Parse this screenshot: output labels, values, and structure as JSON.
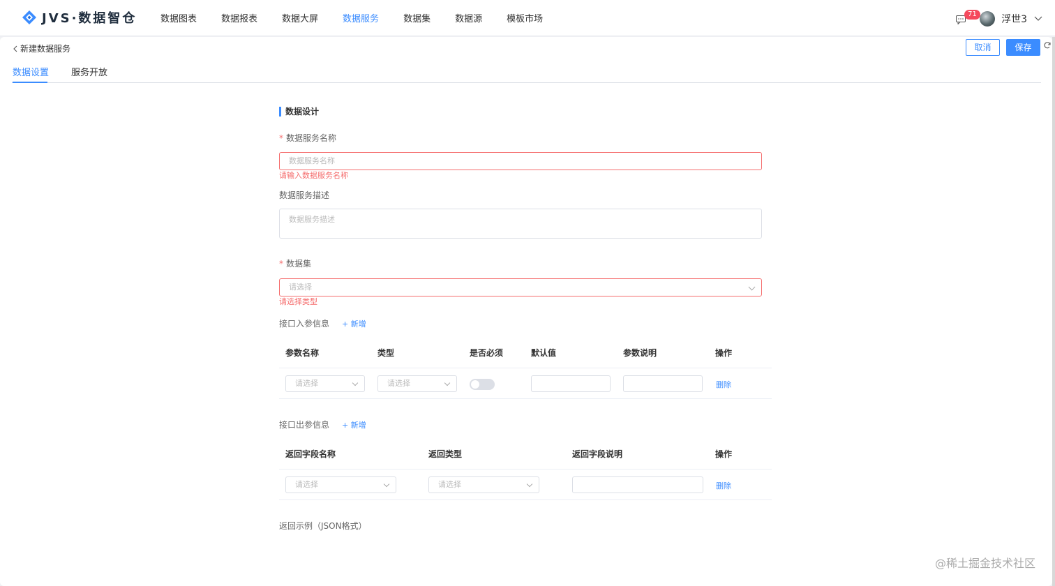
{
  "app": {
    "logo_text": "JVS·数据智仓"
  },
  "nav": {
    "items": [
      {
        "label": "数据图表",
        "active": false
      },
      {
        "label": "数据报表",
        "active": false
      },
      {
        "label": "数据大屏",
        "active": false
      },
      {
        "label": "数据服务",
        "active": true
      },
      {
        "label": "数据集",
        "active": false
      },
      {
        "label": "数据源",
        "active": false
      },
      {
        "label": "模板市场",
        "active": false
      }
    ]
  },
  "user": {
    "badge": "71",
    "name": "浮世3"
  },
  "header": {
    "back_label": "新建数据服务",
    "cancel": "取消",
    "save": "保存"
  },
  "tabs": [
    {
      "label": "数据设置",
      "active": true
    },
    {
      "label": "服务开放",
      "active": false
    }
  ],
  "form": {
    "section_title": "数据设计",
    "name_label": "数据服务名称",
    "name_placeholder": "数据服务名称",
    "name_error": "请输入数据服务名称",
    "desc_label": "数据服务描述",
    "desc_placeholder": "数据服务描述",
    "dataset_label": "数据集",
    "dataset_placeholder": "请选择",
    "dataset_error": "请选择类型",
    "in_params_label": "接口入参信息",
    "add_label": "+ 新增",
    "in_headers": [
      "参数名称",
      "类型",
      "是否必须",
      "默认值",
      "参数说明",
      "操作"
    ],
    "in_row": {
      "name_placeholder": "请选择",
      "type_placeholder": "请选择",
      "delete": "删除"
    },
    "out_params_label": "接口出参信息",
    "out_headers": [
      "返回字段名称",
      "返回类型",
      "返回字段说明",
      "操作"
    ],
    "out_row": {
      "name_placeholder": "请选择",
      "type_placeholder": "请选择",
      "delete": "删除"
    },
    "example_label": "返回示例（JSON格式）"
  },
  "watermark": "@稀土掘金技术社区",
  "colors": {
    "accent": "#3b8cff",
    "error": "#f56c6c"
  }
}
